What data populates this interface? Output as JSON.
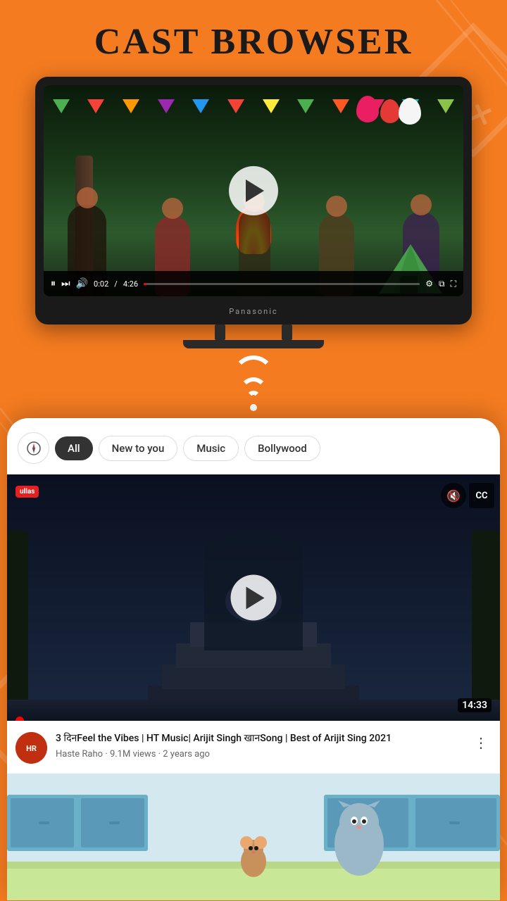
{
  "app": {
    "title": "CAST BROWSER",
    "background_color": "#F47B20"
  },
  "tv": {
    "brand": "Panasonic",
    "progress_time": "0:02",
    "total_time": "4:26"
  },
  "wifi": {
    "label": "wifi-icon"
  },
  "filter_tabs": {
    "compass_icon": "◎",
    "tabs": [
      {
        "id": "all",
        "label": "All",
        "active": true
      },
      {
        "id": "new",
        "label": "New to you",
        "active": false
      },
      {
        "id": "music",
        "label": "Music",
        "active": false
      },
      {
        "id": "bollywood",
        "label": "Bollywood",
        "active": false
      }
    ]
  },
  "video1": {
    "duration": "14:33",
    "title": "3 दिनFeel the Vibes | HT Music| Arijit Singh खानSong | Best of Arijit Sing 2021",
    "channel": "Haste Raho",
    "views": "9.1M views",
    "time_ago": "2 years ago",
    "channel_abbr": "HR",
    "logo_text": "ullas"
  },
  "video2": {
    "placeholder": "Tom & Jerry video thumbnail"
  },
  "icons": {
    "play": "▶",
    "pause": "⏸",
    "skip": "⏭",
    "volume": "🔊",
    "mute": "🔇",
    "cc": "CC",
    "more": "⋮",
    "compass": "◎"
  }
}
